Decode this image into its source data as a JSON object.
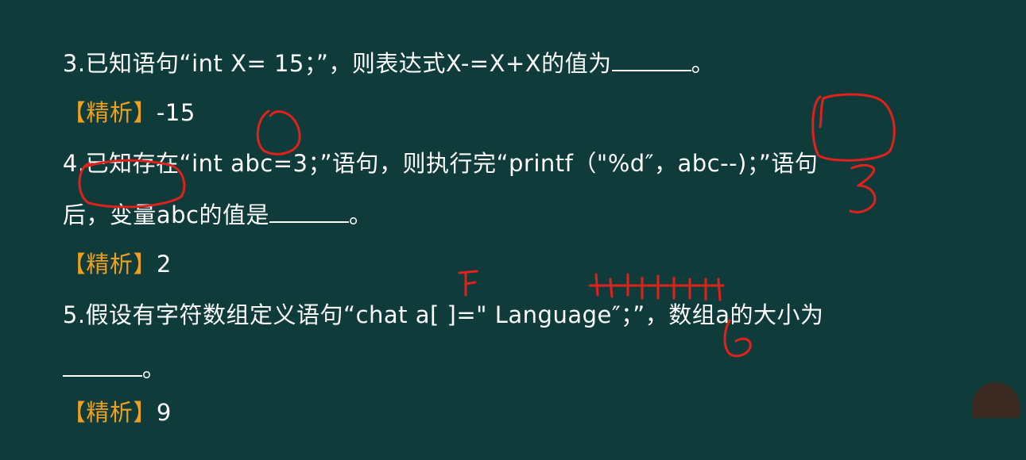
{
  "q3": {
    "text": "3.已知语句“int X= 15；”，则表达式X-=X+X的值为",
    "suffix": "。"
  },
  "a3": {
    "open": "【",
    "label": "精析",
    "close": "】",
    "value": "-15"
  },
  "q4": {
    "line1": "4.已知存在“int abc=3；”语句，则执行完“printf（\"%d″，abc--)；”语句",
    "line2_prefix": "后，变量abc的值是",
    "suffix": "。"
  },
  "a4": {
    "open": "【",
    "label": "精析",
    "close": "】",
    "value": "2"
  },
  "q5": {
    "line1": "5.假设有字符数组定义语句“chat a[ ]=\" Language″；”，数组a的大小为",
    "suffix": "。"
  },
  "a5": {
    "open": "【",
    "label": "精析",
    "close": "】",
    "value": "9"
  },
  "annotations": {
    "note_three": "3",
    "note_six": "6",
    "ink_color": "#e0211c"
  }
}
